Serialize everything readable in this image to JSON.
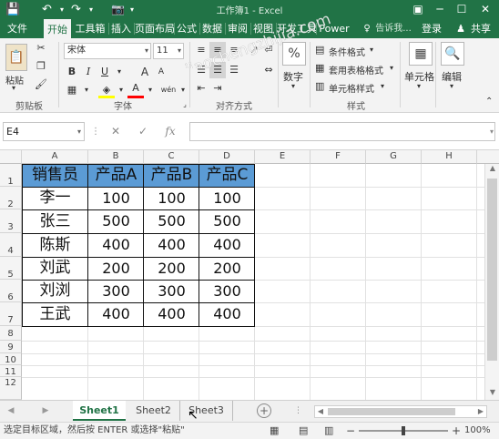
{
  "app": {
    "title": "工作簿1 - Excel",
    "login": "登录",
    "share": "共享",
    "tell_me": "告诉我..."
  },
  "ribbon_tabs": [
    "文件",
    "开始",
    "工具箱",
    "插入",
    "页面布局",
    "公式",
    "数据",
    "审阅",
    "视图",
    "开发工具",
    "Power"
  ],
  "home": {
    "clipboard": {
      "paste": "粘贴",
      "label": "剪贴板"
    },
    "font": {
      "name": "宋体",
      "size": "11",
      "label": "字体",
      "bold": "B",
      "italic": "I",
      "underline": "U",
      "grow": "A",
      "shrink": "A",
      "font_color": "A",
      "phonetic": "wén"
    },
    "alignment": {
      "label": "对齐方式"
    },
    "number": {
      "label": "数字",
      "icon": "%"
    },
    "styles": {
      "label": "样式",
      "conditional": "条件格式",
      "table": "套用表格格式",
      "cell_styles": "单元格样式"
    },
    "cells": {
      "label": "单元格"
    },
    "editing": {
      "label": "编辑"
    }
  },
  "formula_bar": {
    "name_box": "E4",
    "cancel": "✕",
    "enter": "✓",
    "fx": "fx",
    "value": ""
  },
  "grid": {
    "columns": [
      "A",
      "B",
      "C",
      "D",
      "E",
      "F",
      "G",
      "H"
    ],
    "rows": [
      "1",
      "2",
      "3",
      "4",
      "5",
      "6",
      "7",
      "8",
      "9",
      "10",
      "11",
      "12"
    ],
    "table": {
      "headers": [
        "销售员",
        "产品A",
        "产品B",
        "产品C"
      ],
      "rows": [
        [
          "李一",
          "100",
          "100",
          "100"
        ],
        [
          "张三",
          "500",
          "500",
          "500"
        ],
        [
          "陈斯",
          "400",
          "400",
          "400"
        ],
        [
          "刘武",
          "200",
          "200",
          "200"
        ],
        [
          "刘浏",
          "300",
          "300",
          "300"
        ],
        [
          "王武",
          "400",
          "400",
          "400"
        ]
      ]
    },
    "header_fill": "#5B9BD5"
  },
  "sheets": {
    "tabs": [
      "Sheet1",
      "Sheet2",
      "Sheet3"
    ],
    "active": "Sheet1",
    "add": "+"
  },
  "status": {
    "message": "选定目标区域，然后按 ENTER 或选择\"粘贴\"",
    "zoom": "100%",
    "zoom_minus": "−",
    "zoom_plus": "+"
  },
  "watermark": "jiaochengzhijia.com"
}
